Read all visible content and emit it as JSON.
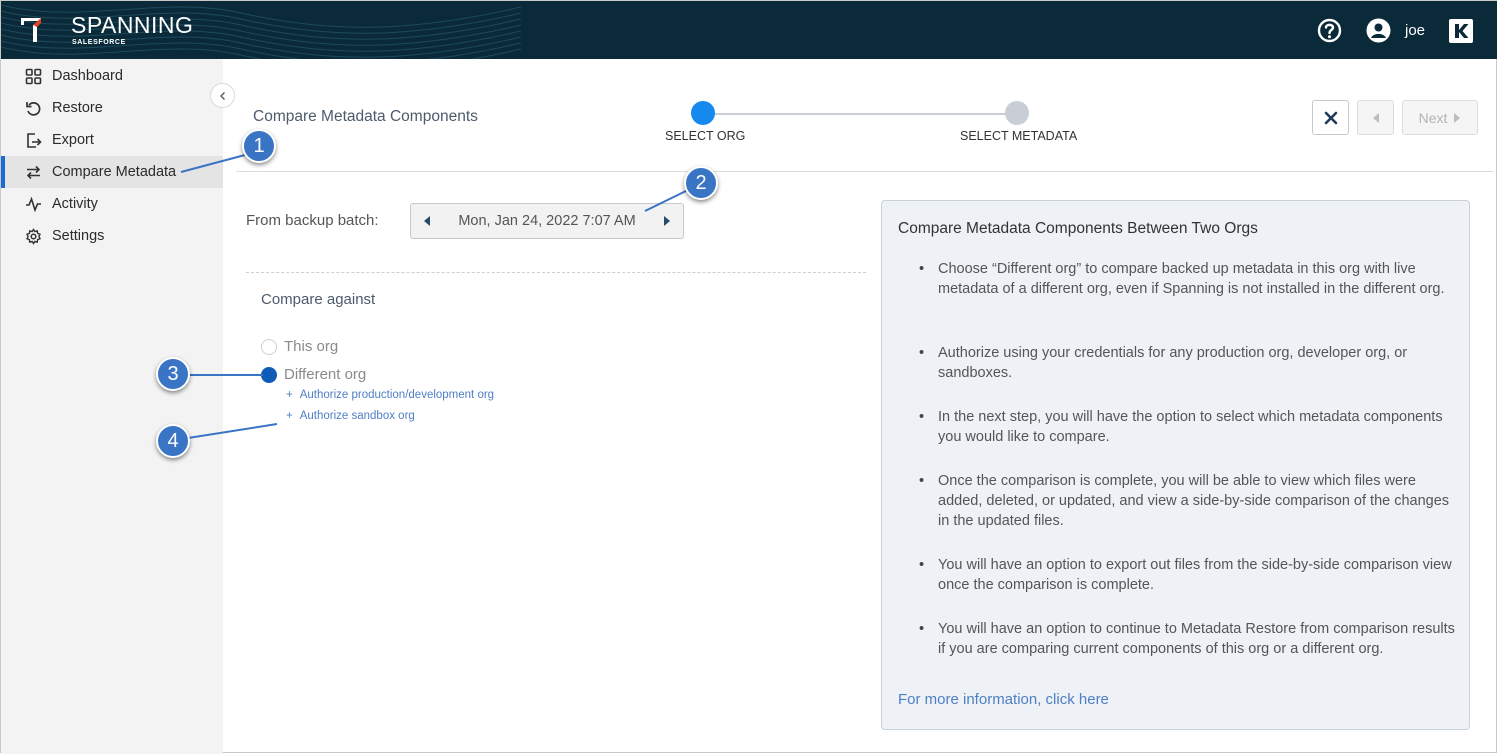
{
  "header": {
    "brand": "SPANNING",
    "brand_sub": "SALESFORCE",
    "user": "joe",
    "icons": [
      "help-icon",
      "user-icon",
      "kaseya-icon"
    ]
  },
  "sidebar": {
    "items": [
      {
        "label": "Dashboard",
        "icon": "dashboard-icon"
      },
      {
        "label": "Restore",
        "icon": "restore-icon"
      },
      {
        "label": "Export",
        "icon": "export-icon"
      },
      {
        "label": "Compare Metadata",
        "icon": "compare-icon",
        "active": true
      },
      {
        "label": "Activity",
        "icon": "activity-icon"
      },
      {
        "label": "Settings",
        "icon": "gear-icon"
      }
    ]
  },
  "main": {
    "title": "Compare Metadata Components",
    "steps": [
      {
        "label": "SELECT ORG",
        "active": true
      },
      {
        "label": "SELECT METADATA",
        "active": false
      }
    ],
    "next_label": "Next",
    "from_backup_label": "From backup batch:",
    "backup_batch": "Mon, Jan 24, 2022 7:07 AM",
    "compare_against_label": "Compare against",
    "radios": [
      {
        "label": "This org",
        "selected": false
      },
      {
        "label": "Different org",
        "selected": true
      }
    ],
    "auth_links": [
      "Authorize production/development org",
      "Authorize sandbox org"
    ]
  },
  "info": {
    "title": "Compare Metadata Components Between Two Orgs",
    "bullets": [
      "Choose “Different org” to compare backed up metadata in this org with live metadata of a different org, even if Spanning is not installed in the different org.",
      "Authorize using your credentials for any production org, developer org, or sandboxes.",
      "In the next step, you will have the option to select which metadata components you would like to compare.",
      "Once the comparison is complete, you will be able to view which files were added, deleted, or updated, and view a side-by-side comparison of the changes in the updated files.",
      "You will have an option to export out files from the side-by-side comparison view once the comparison is complete.",
      "You will have an option to continue to Metadata Restore from comparison results if you are comparing current components of this org or a different org."
    ],
    "link": "For more information, click here"
  },
  "callouts": [
    "1",
    "2",
    "3",
    "4"
  ],
  "colors": {
    "header_bg": "#0a2a3a",
    "accent": "#1589ee",
    "link": "#4f7fc4",
    "callout": "#3a74c5"
  }
}
